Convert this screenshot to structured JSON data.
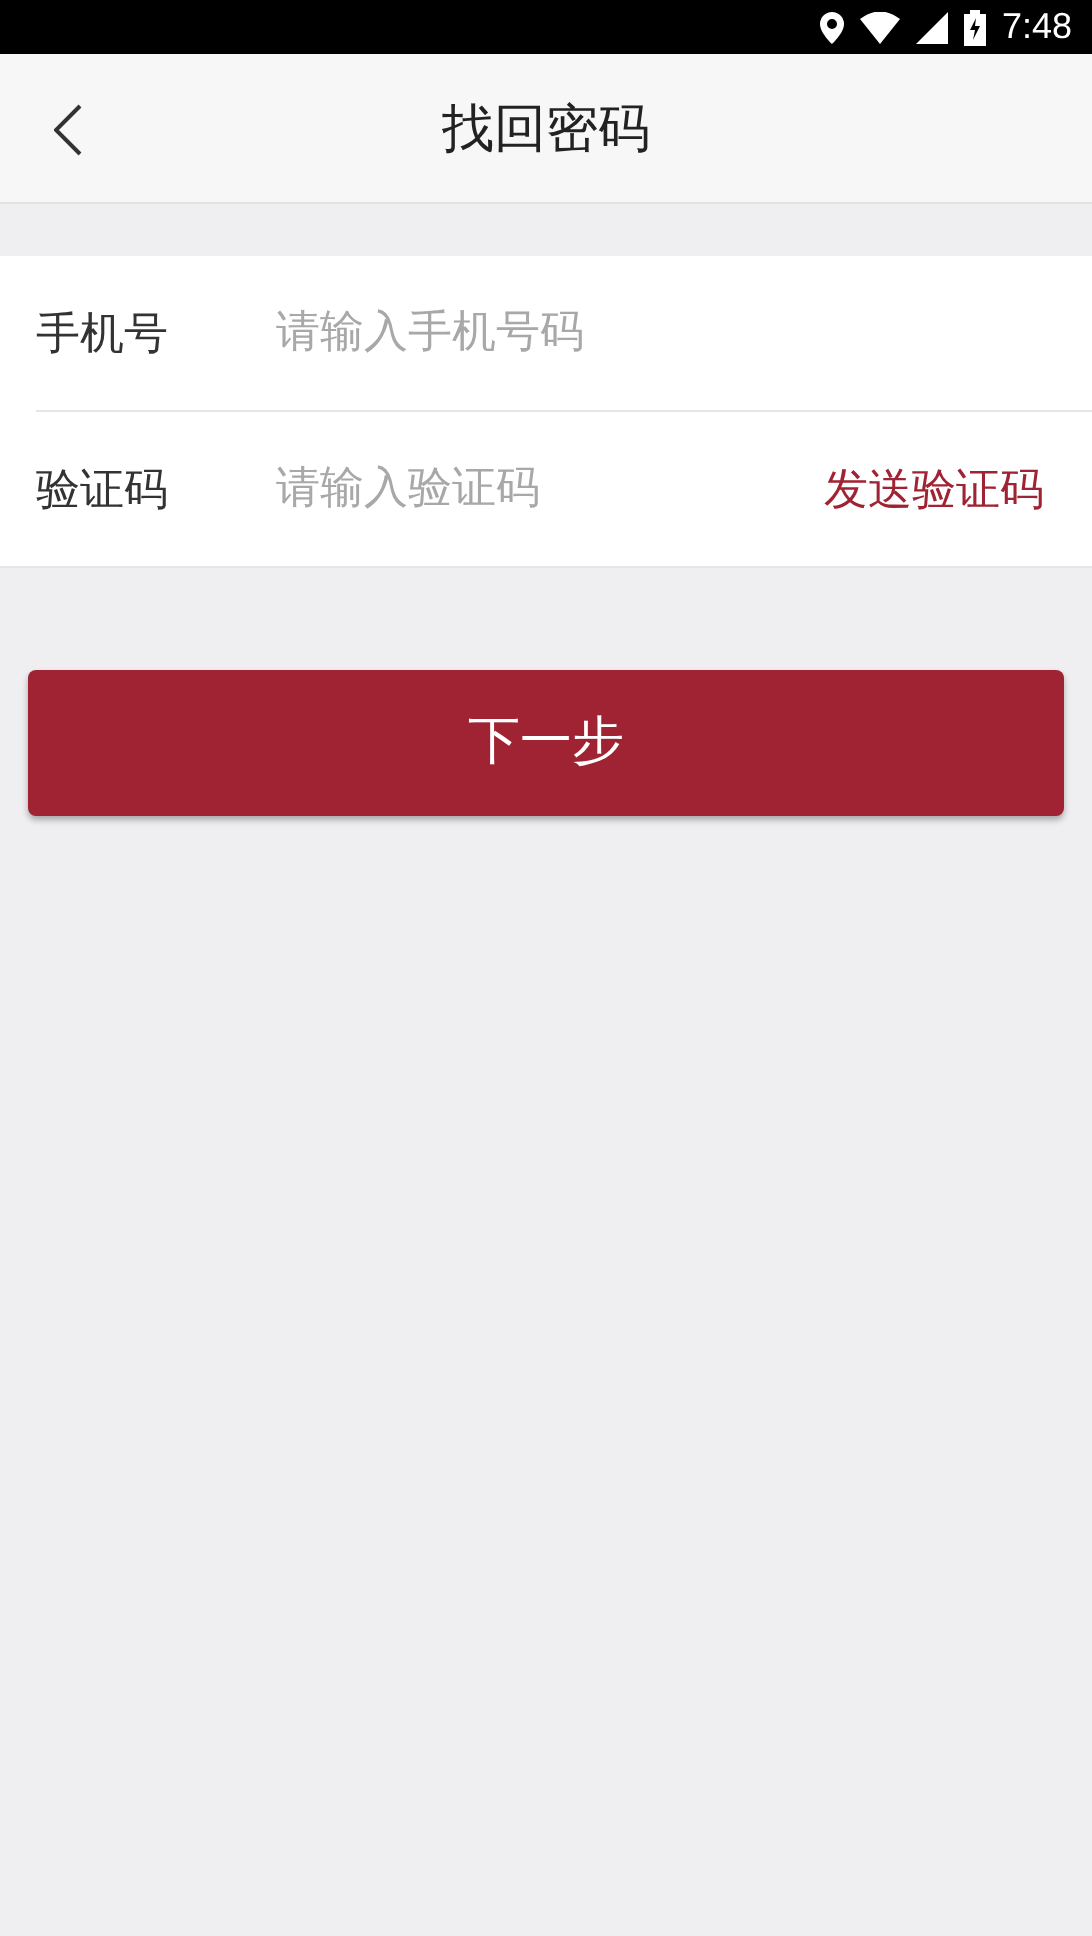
{
  "status_bar": {
    "time": "7:48"
  },
  "header": {
    "title": "找回密码"
  },
  "fields": [
    {
      "label": "手机号",
      "placeholder": "请输入手机号码"
    },
    {
      "label": "验证码",
      "placeholder": "请输入验证码",
      "action": "发送验证码"
    }
  ],
  "submit": {
    "label": "下一步"
  }
}
